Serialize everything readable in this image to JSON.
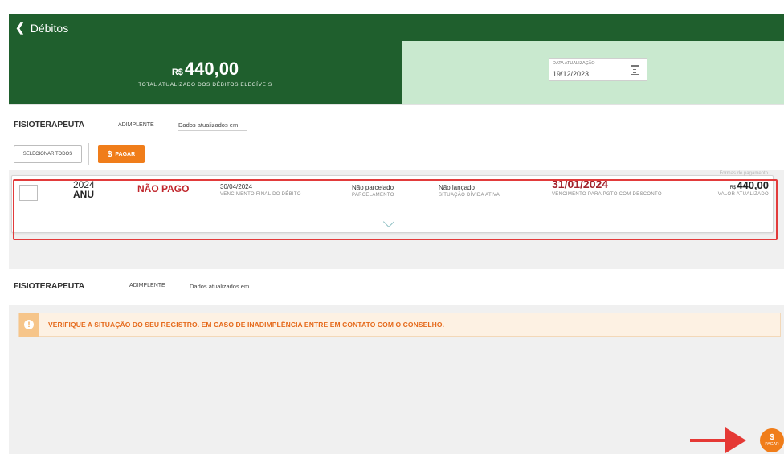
{
  "topbar": {
    "back_label": "Débitos"
  },
  "summary": {
    "currency": "R$",
    "total_value": "440,00",
    "total_caption": "TOTAL ATUALIZADO DOS DÉBITOS ELEGÍVEIS",
    "date_label": "DATA ATUALIZAÇÃO",
    "date_value": "19/12/2023"
  },
  "section1": {
    "profession": "FISIOTERAPEUTA",
    "status": "ADIMPLENTE",
    "updated_label": "Dados atualizados em",
    "select_all_label": "SELECIONAR TODOS",
    "pay_icon": "$",
    "pay_label": "PAGAR"
  },
  "debt": {
    "year": "2024",
    "type": "ANU",
    "payment_status": "NÃO PAGO",
    "due_date": "30/04/2024",
    "due_date_label": "VENCIMENTO FINAL DO DÉBITO",
    "installment": "Não parcelado",
    "installment_label": "PARCELAMENTO",
    "active_debt": "Não lançado",
    "active_debt_label": "SITUAÇÃO DÍVIDA ATIVA",
    "discount_date": "31/01/2024",
    "discount_date_label": "VENCIMENTO PARA PGTO COM DESCONTO",
    "currency": "R$",
    "updated_value": "440,00",
    "updated_value_label": "VALOR ATUALIZADO",
    "top_links": "Formas de pagamento"
  },
  "section2": {
    "profession": "FISIOTERAPEUTA",
    "status": "ADIMPLENTE",
    "updated_label": "Dados atualizados em"
  },
  "alert": {
    "icon": "!",
    "message": "VERIFIQUE A SITUAÇÃO DO SEU REGISTRO. EM CASO DE INADIMPLÊNCIA ENTRE EM CONTATO COM O CONSELHO."
  },
  "fab": {
    "icon": "$",
    "label": "PAGAR"
  },
  "colors": {
    "dark_green": "#1f5f2d",
    "light_green": "#c9e9cf",
    "orange": "#f07d1a",
    "debt_red": "#c0272d",
    "highlight_red": "#e23b3b"
  }
}
